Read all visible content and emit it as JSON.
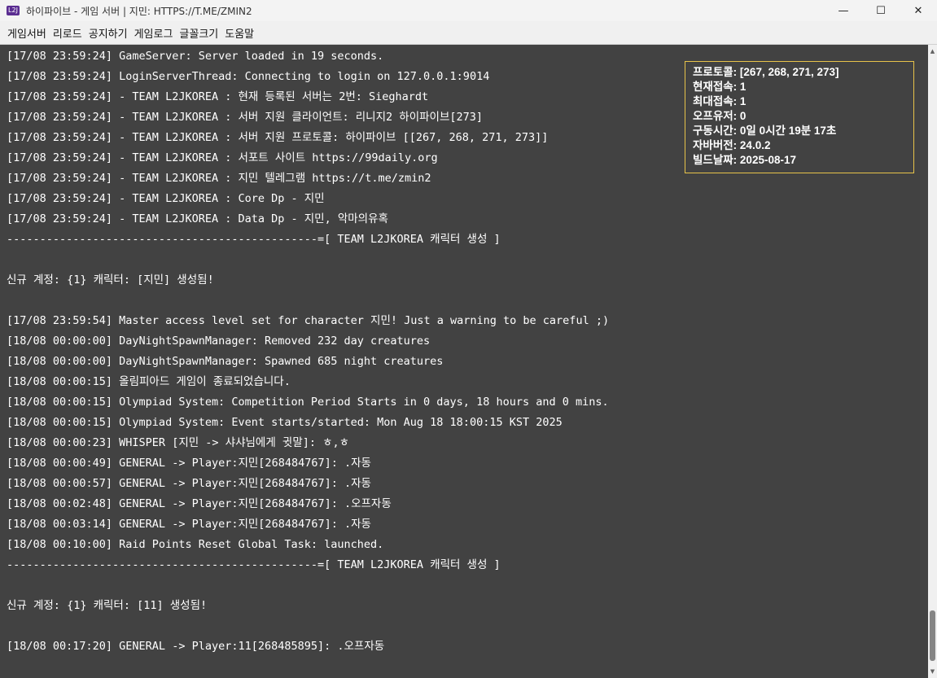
{
  "window": {
    "title": "하이파이브 - 게임 서버 | 지민: HTTPS://T.ME/ZMIN2",
    "icon_label": "L2J",
    "minimize_glyph": "—",
    "maximize_glyph": "☐",
    "close_glyph": "✕"
  },
  "menu": [
    "게임서버",
    "리로드",
    "공지하기",
    "게임로그",
    "글꼴크기",
    "도움말"
  ],
  "log": [
    "[17/08 23:59:24] GameServer: Server loaded in 19 seconds.",
    "[17/08 23:59:24] LoginServerThread: Connecting to login on 127.0.0.1:9014",
    "[17/08 23:59:24] - TEAM L2JKOREA : 현재 등록된 서버는 2번: Sieghardt",
    "[17/08 23:59:24] - TEAM L2JKOREA : 서버 지원 클라이언트: 리니지2 하이파이브[273]",
    "[17/08 23:59:24] - TEAM L2JKOREA : 서버 지원 프로토콜: 하이파이브 [[267, 268, 271, 273]]",
    "[17/08 23:59:24] - TEAM L2JKOREA : 서포트 사이트 https://99daily.org",
    "[17/08 23:59:24] - TEAM L2JKOREA : 지민 텔레그램 https://t.me/zmin2",
    "[17/08 23:59:24] - TEAM L2JKOREA : Core Dp - 지민",
    "[17/08 23:59:24] - TEAM L2JKOREA : Data Dp - 지민, 악마의유혹",
    "-----------------------------------------------=[ TEAM L2JKOREA 캐릭터 생성 ]",
    "",
    "신규 계정: {1} 캐릭터: [지민] 생성됨!",
    "",
    "[17/08 23:59:54] Master access level set for character 지민! Just a warning to be careful ;)",
    "[18/08 00:00:00] DayNightSpawnManager: Removed 232 day creatures",
    "[18/08 00:00:00] DayNightSpawnManager: Spawned 685 night creatures",
    "[18/08 00:00:15] 올림피아드 게임이 종료되었습니다.",
    "[18/08 00:00:15] Olympiad System: Competition Period Starts in 0 days, 18 hours and 0 mins.",
    "[18/08 00:00:15] Olympiad System: Event starts/started: Mon Aug 18 18:00:15 KST 2025",
    "[18/08 00:00:23] WHISPER [지민 -> 샤샤님에게 귓말]: ㅎ,ㅎ",
    "[18/08 00:00:49] GENERAL -> Player:지민[268484767]: .자동",
    "[18/08 00:00:57] GENERAL -> Player:지민[268484767]: .자동",
    "[18/08 00:02:48] GENERAL -> Player:지민[268484767]: .오프자동",
    "[18/08 00:03:14] GENERAL -> Player:지민[268484767]: .자동",
    "[18/08 00:10:00] Raid Points Reset Global Task: launched.",
    "-----------------------------------------------=[ TEAM L2JKOREA 캐릭터 생성 ]",
    "",
    "신규 계정: {1} 캐릭터: [11] 생성됨!",
    "",
    "[18/08 00:17:20] GENERAL -> Player:11[268485895]: .오프자동"
  ],
  "info": {
    "protocol": "프로토콜: [267, 268, 271, 273]",
    "current": "현재접속: 1",
    "max": "최대접속: 1",
    "offline": "오프유저: 0",
    "uptime": "구동시간: 0일 0시간 19분 17초",
    "java": "자바버전: 24.0.2",
    "build": "빌드날짜: 2025-08-17"
  },
  "colors": {
    "console_bg": "#424242",
    "info_border": "#e7c34a",
    "text": "#ffffff"
  },
  "scroll": {
    "up_glyph": "▲",
    "down_glyph": "▼"
  }
}
